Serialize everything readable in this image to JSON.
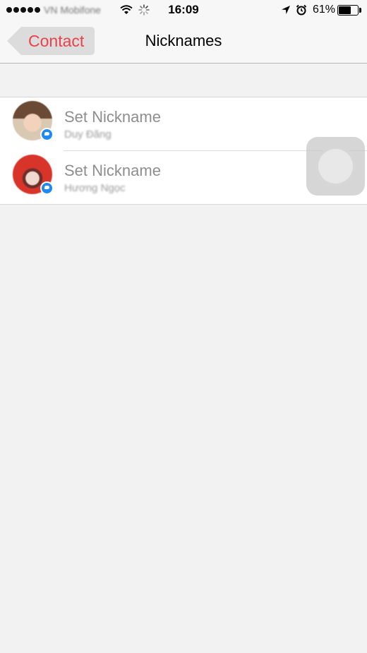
{
  "status_bar": {
    "carrier": "VN Mobifone",
    "time": "16:09",
    "battery_percent": "61%",
    "battery_level": 0.61,
    "signal_bars": 5,
    "icons": [
      "wifi-icon",
      "activity-icon",
      "location-icon",
      "alarm-icon",
      "battery-icon"
    ]
  },
  "nav": {
    "back_label": "Contact",
    "title": "Nicknames",
    "accent_color": "#e8424a"
  },
  "list": {
    "items": [
      {
        "title": "Set Nickname",
        "subtitle": "Duy Đăng"
      },
      {
        "title": "Set Nickname",
        "subtitle": "Hương Ngọc"
      }
    ]
  }
}
